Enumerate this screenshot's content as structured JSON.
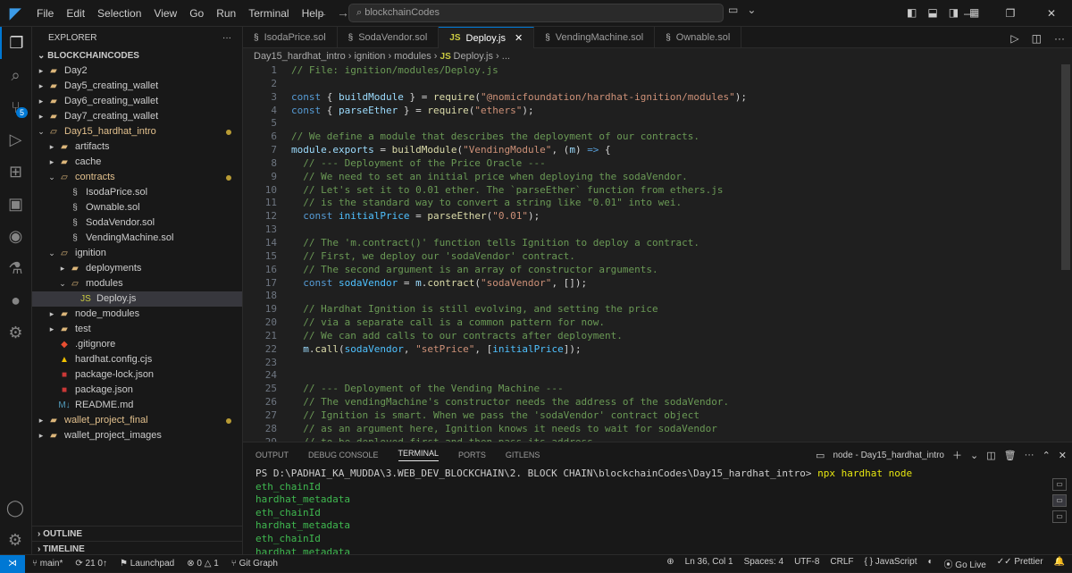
{
  "titlebar": {
    "menu": [
      "File",
      "Edit",
      "Selection",
      "View",
      "Go",
      "Run",
      "Terminal",
      "Help"
    ],
    "search": "blockchainCodes"
  },
  "explorer": {
    "title": "EXPLORER",
    "root": "BLOCKCHAINCODES",
    "items": [
      {
        "label": "Day2",
        "type": "folder",
        "depth": 1
      },
      {
        "label": "Day5_creating_wallet",
        "type": "folder",
        "depth": 1
      },
      {
        "label": "Day6_creating_wallet",
        "type": "folder",
        "depth": 1
      },
      {
        "label": "Day7_creating_wallet",
        "type": "folder",
        "depth": 1
      },
      {
        "label": "Day15_hardhat_intro",
        "type": "folder-open",
        "depth": 1,
        "modified": true
      },
      {
        "label": "artifacts",
        "type": "folder",
        "depth": 2
      },
      {
        "label": "cache",
        "type": "folder",
        "depth": 2
      },
      {
        "label": "contracts",
        "type": "folder-open",
        "depth": 2,
        "modified": true
      },
      {
        "label": "IsodaPrice.sol",
        "type": "sol",
        "depth": 3
      },
      {
        "label": "Ownable.sol",
        "type": "sol",
        "depth": 3
      },
      {
        "label": "SodaVendor.sol",
        "type": "sol",
        "depth": 3
      },
      {
        "label": "VendingMachine.sol",
        "type": "sol",
        "depth": 3
      },
      {
        "label": "ignition",
        "type": "folder-open",
        "depth": 2
      },
      {
        "label": "deployments",
        "type": "folder",
        "depth": 3
      },
      {
        "label": "modules",
        "type": "folder-open",
        "depth": 3
      },
      {
        "label": "Deploy.js",
        "type": "js",
        "depth": 4,
        "selected": true
      },
      {
        "label": "node_modules",
        "type": "folder",
        "depth": 2
      },
      {
        "label": "test",
        "type": "folder",
        "depth": 2
      },
      {
        "label": ".gitignore",
        "type": "git",
        "depth": 2
      },
      {
        "label": "hardhat.config.cjs",
        "type": "warn",
        "depth": 2
      },
      {
        "label": "package-lock.json",
        "type": "npm",
        "depth": 2
      },
      {
        "label": "package.json",
        "type": "npm",
        "depth": 2
      },
      {
        "label": "README.md",
        "type": "md",
        "depth": 2
      },
      {
        "label": "wallet_project_final",
        "type": "folder",
        "depth": 1,
        "modified": true
      },
      {
        "label": "wallet_project_images",
        "type": "folder",
        "depth": 1
      }
    ],
    "outline": "OUTLINE",
    "timeline": "TIMELINE"
  },
  "tabs": [
    {
      "label": "IsodaPrice.sol",
      "icon": "sol"
    },
    {
      "label": "SodaVendor.sol",
      "icon": "sol"
    },
    {
      "label": "Deploy.js",
      "icon": "js",
      "active": true
    },
    {
      "label": "VendingMachine.sol",
      "icon": "sol"
    },
    {
      "label": "Ownable.sol",
      "icon": "sol"
    }
  ],
  "breadcrumb": [
    "Day15_hardhat_intro",
    "ignition",
    "modules",
    "Deploy.js",
    "..."
  ],
  "code": [
    [
      {
        "t": "// File: ignition/modules/Deploy.js",
        "c": "cm"
      }
    ],
    [],
    [
      {
        "t": "const ",
        "c": "kw"
      },
      {
        "t": "{ ",
        "c": "p"
      },
      {
        "t": "buildModule",
        "c": "v"
      },
      {
        "t": " } = ",
        "c": "p"
      },
      {
        "t": "require",
        "c": "fn"
      },
      {
        "t": "(",
        "c": "p"
      },
      {
        "t": "\"@nomicfoundation/hardhat-ignition/modules\"",
        "c": "str"
      },
      {
        "t": ");",
        "c": "p"
      }
    ],
    [
      {
        "t": "const ",
        "c": "kw"
      },
      {
        "t": "{ ",
        "c": "p"
      },
      {
        "t": "parseEther",
        "c": "v"
      },
      {
        "t": " } = ",
        "c": "p"
      },
      {
        "t": "require",
        "c": "fn"
      },
      {
        "t": "(",
        "c": "p"
      },
      {
        "t": "\"ethers\"",
        "c": "str"
      },
      {
        "t": ");",
        "c": "p"
      }
    ],
    [],
    [
      {
        "t": "// We define a module that describes the deployment of our contracts.",
        "c": "cm"
      }
    ],
    [
      {
        "t": "module",
        "c": "v"
      },
      {
        "t": ".",
        "c": "p"
      },
      {
        "t": "exports",
        "c": "v"
      },
      {
        "t": " = ",
        "c": "p"
      },
      {
        "t": "buildModule",
        "c": "fn"
      },
      {
        "t": "(",
        "c": "p"
      },
      {
        "t": "\"VendingModule\"",
        "c": "str"
      },
      {
        "t": ", (",
        "c": "p"
      },
      {
        "t": "m",
        "c": "v"
      },
      {
        "t": ") ",
        "c": "p"
      },
      {
        "t": "=>",
        "c": "kw"
      },
      {
        "t": " {",
        "c": "p"
      }
    ],
    [
      {
        "t": "  // --- Deployment of the Price Oracle ---",
        "c": "cm"
      }
    ],
    [
      {
        "t": "  // We need to set an initial price when deploying the sodaVendor.",
        "c": "cm"
      }
    ],
    [
      {
        "t": "  // Let's set it to 0.01 ether. The `parseEther` function from ethers.js",
        "c": "cm"
      }
    ],
    [
      {
        "t": "  // is the standard way to convert a string like \"0.01\" into wei.",
        "c": "cm"
      }
    ],
    [
      {
        "t": "  const ",
        "c": "kw"
      },
      {
        "t": "initialPrice",
        "c": "cst"
      },
      {
        "t": " = ",
        "c": "p"
      },
      {
        "t": "parseEther",
        "c": "fn"
      },
      {
        "t": "(",
        "c": "p"
      },
      {
        "t": "\"0.01\"",
        "c": "str"
      },
      {
        "t": ");",
        "c": "p"
      }
    ],
    [],
    [
      {
        "t": "  // The 'm.contract()' function tells Ignition to deploy a contract.",
        "c": "cm"
      }
    ],
    [
      {
        "t": "  // First, we deploy our 'sodaVendor' contract.",
        "c": "cm"
      }
    ],
    [
      {
        "t": "  // The second argument is an array of constructor arguments.",
        "c": "cm"
      }
    ],
    [
      {
        "t": "  const ",
        "c": "kw"
      },
      {
        "t": "sodaVendor",
        "c": "cst"
      },
      {
        "t": " = ",
        "c": "p"
      },
      {
        "t": "m",
        "c": "v"
      },
      {
        "t": ".",
        "c": "p"
      },
      {
        "t": "contract",
        "c": "fn"
      },
      {
        "t": "(",
        "c": "p"
      },
      {
        "t": "\"sodaVendor\"",
        "c": "str"
      },
      {
        "t": ", []);",
        "c": "p"
      }
    ],
    [],
    [
      {
        "t": "  // Hardhat Ignition is still evolving, and setting the price",
        "c": "cm"
      }
    ],
    [
      {
        "t": "  // via a separate call is a common pattern for now.",
        "c": "cm"
      }
    ],
    [
      {
        "t": "  // We can add calls to our contracts after deployment.",
        "c": "cm"
      }
    ],
    [
      {
        "t": "  m",
        "c": "v"
      },
      {
        "t": ".",
        "c": "p"
      },
      {
        "t": "call",
        "c": "fn"
      },
      {
        "t": "(",
        "c": "p"
      },
      {
        "t": "sodaVendor",
        "c": "cst"
      },
      {
        "t": ", ",
        "c": "p"
      },
      {
        "t": "\"setPrice\"",
        "c": "str"
      },
      {
        "t": ", [",
        "c": "p"
      },
      {
        "t": "initialPrice",
        "c": "cst"
      },
      {
        "t": "]);",
        "c": "p"
      }
    ],
    [],
    [],
    [
      {
        "t": "  // --- Deployment of the Vending Machine ---",
        "c": "cm"
      }
    ],
    [
      {
        "t": "  // The vendingMachine's constructor needs the address of the sodaVendor.",
        "c": "cm"
      }
    ],
    [
      {
        "t": "  // Ignition is smart. When we pass the 'sodaVendor' contract object",
        "c": "cm"
      }
    ],
    [
      {
        "t": "  // as an argument here, Ignition knows it needs to wait for sodaVendor",
        "c": "cm"
      }
    ],
    [
      {
        "t": "  // to be deployed first and then pass its address.",
        "c": "cm"
      }
    ]
  ],
  "panel": {
    "tabs": [
      "OUTPUT",
      "DEBUG CONSOLE",
      "TERMINAL",
      "PORTS",
      "GITLENS"
    ],
    "active_tab": "TERMINAL",
    "terminal_label": "node - Day15_hardhat_intro",
    "prompt": "PS D:\\PADHAI_KA_MUDDA\\3.WEB_DEV_BLOCKCHAIN\\2. BLOCK CHAIN\\blockchainCodes\\Day15_hardhat_intro> ",
    "command": "npx hardhat node",
    "output": [
      "eth_chainId",
      "hardhat_metadata",
      "eth_chainId",
      "hardhat_metadata",
      "eth_chainId",
      "hardhat_metadata"
    ]
  },
  "status": {
    "branch": "main*",
    "sync": "21 0↑",
    "launchpad": "Launchpad",
    "problems": "0 △ 1",
    "gitgraph": "Git Graph",
    "position": "Ln 36, Col 1",
    "spaces": "Spaces: 4",
    "encoding": "UTF-8",
    "eol": "CRLF",
    "language": "JavaScript",
    "golive": "Go Live",
    "prettier": "Prettier"
  },
  "colors": {
    "cm": "#6a9955",
    "kw": "#569cd6",
    "fn": "#dcdcaa",
    "str": "#ce9178",
    "v": "#9cdcfe",
    "cst": "#4fc1ff",
    "p": "#d4d4d4"
  }
}
